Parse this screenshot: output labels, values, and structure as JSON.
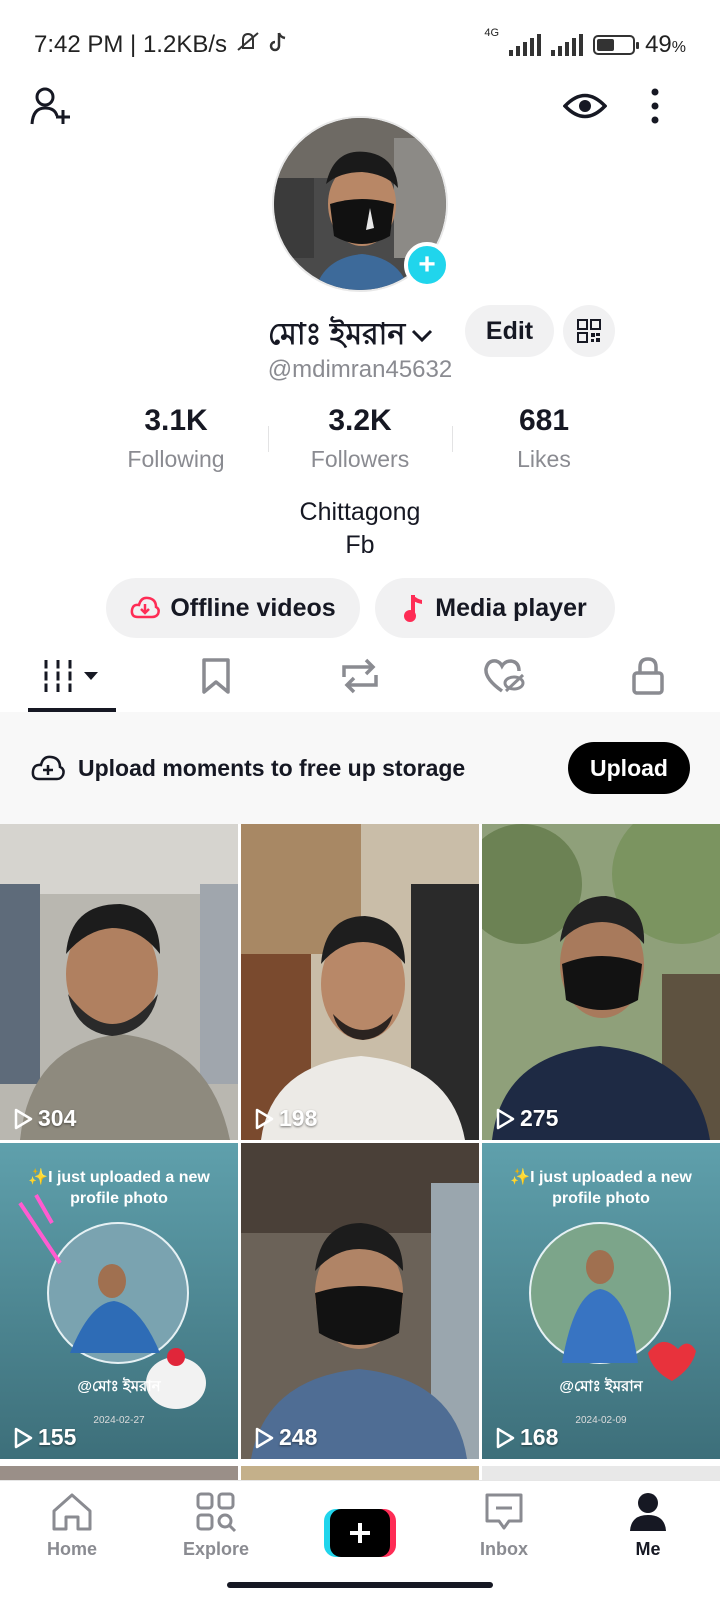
{
  "status_bar": {
    "time": "7:42 PM | 1.2KB/s",
    "network": "4G",
    "battery": "49",
    "battery_unit": "%",
    "battery_level": 0.49
  },
  "header": {
    "add_friend_icon": "person-plus-icon",
    "views_icon": "eye-icon",
    "menu_icon": "more-vertical-icon"
  },
  "profile": {
    "display_name": "মোঃ ইমরান",
    "username": "@mdimran45632",
    "edit_label": "Edit",
    "bio": [
      "Chittagong",
      "Fb"
    ]
  },
  "stats": [
    {
      "value": "3.1K",
      "label": "Following"
    },
    {
      "value": "3.2K",
      "label": "Followers"
    },
    {
      "value": "681",
      "label": "Likes"
    }
  ],
  "actions": {
    "offline_videos": "Offline videos",
    "media_player": "Media player"
  },
  "tabs": [
    "videos-grid-icon",
    "bookmark-icon",
    "repost-icon",
    "liked-hidden-icon",
    "lock-icon"
  ],
  "upload_banner": {
    "text": "Upload moments to free up storage",
    "button": "Upload"
  },
  "videos": [
    {
      "views": "304"
    },
    {
      "views": "198"
    },
    {
      "views": "275"
    },
    {
      "views": "155",
      "caption": "✨I just uploaded a new profile photo",
      "handle": "@মোঃ ইমরান",
      "date": "2024-02-27"
    },
    {
      "views": "248"
    },
    {
      "views": "168",
      "caption": "✨I just uploaded a new profile photo",
      "handle": "@মোঃ ইমরান",
      "date": "2024-02-09"
    }
  ],
  "bottom_nav": [
    {
      "label": "Home"
    },
    {
      "label": "Explore"
    },
    {
      "label": ""
    },
    {
      "label": "Inbox"
    },
    {
      "label": "Me"
    }
  ],
  "colors": {
    "accent_cyan": "#20d5ec",
    "accent_red": "#fe2c55",
    "text_primary": "#161823",
    "text_secondary": "#8a8b91"
  }
}
